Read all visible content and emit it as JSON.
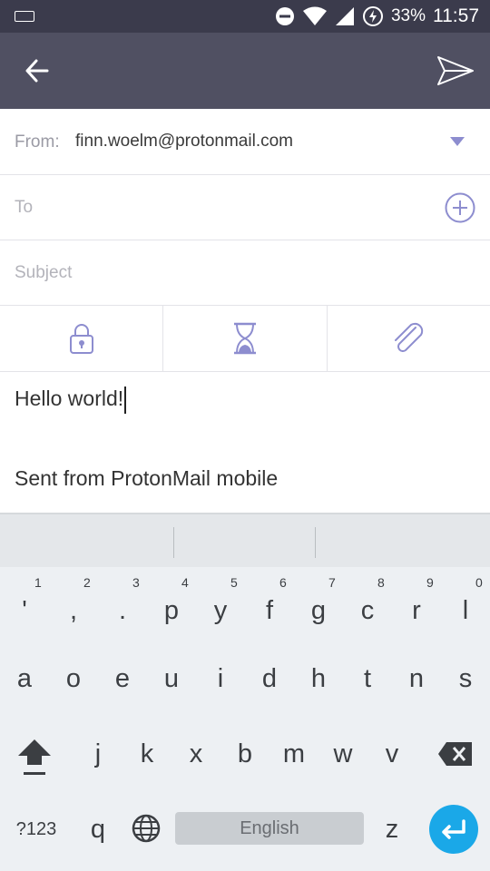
{
  "status_bar": {
    "battery": "33%",
    "time": "11:57"
  },
  "compose": {
    "from_label": "From:",
    "from_value": "finn.woelm@protonmail.com",
    "to_placeholder": "To",
    "subject_placeholder": "Subject",
    "body_line1": "Hello world!",
    "body_line2": "Sent from ProtonMail mobile"
  },
  "colors": {
    "accent": "#8d8dcf",
    "appbar": "#505062",
    "status": "#3b3b4c",
    "enter": "#1aa8e8"
  },
  "icons": [
    "arrow-back-icon",
    "send-icon",
    "dropdown-icon",
    "add-contact-icon",
    "lock-icon",
    "hourglass-icon",
    "paperclip-icon",
    "shift-icon",
    "backspace-icon",
    "globe-icon",
    "enter-icon"
  ],
  "keyboard": {
    "row1": [
      {
        "key": "'",
        "hint": "1"
      },
      {
        "key": ",",
        "hint": "2"
      },
      {
        "key": ".",
        "hint": "3"
      },
      {
        "key": "p",
        "hint": "4"
      },
      {
        "key": "y",
        "hint": "5"
      },
      {
        "key": "f",
        "hint": "6"
      },
      {
        "key": "g",
        "hint": "7"
      },
      {
        "key": "c",
        "hint": "8"
      },
      {
        "key": "r",
        "hint": "9"
      },
      {
        "key": "l",
        "hint": "0"
      }
    ],
    "row2": [
      "a",
      "o",
      "e",
      "u",
      "i",
      "d",
      "h",
      "t",
      "n",
      "s"
    ],
    "row3": [
      "j",
      "k",
      "x",
      "b",
      "m",
      "w",
      "v"
    ],
    "symbols_key": "?123",
    "q_key": "q",
    "space_label": "English",
    "z_key": "z"
  }
}
